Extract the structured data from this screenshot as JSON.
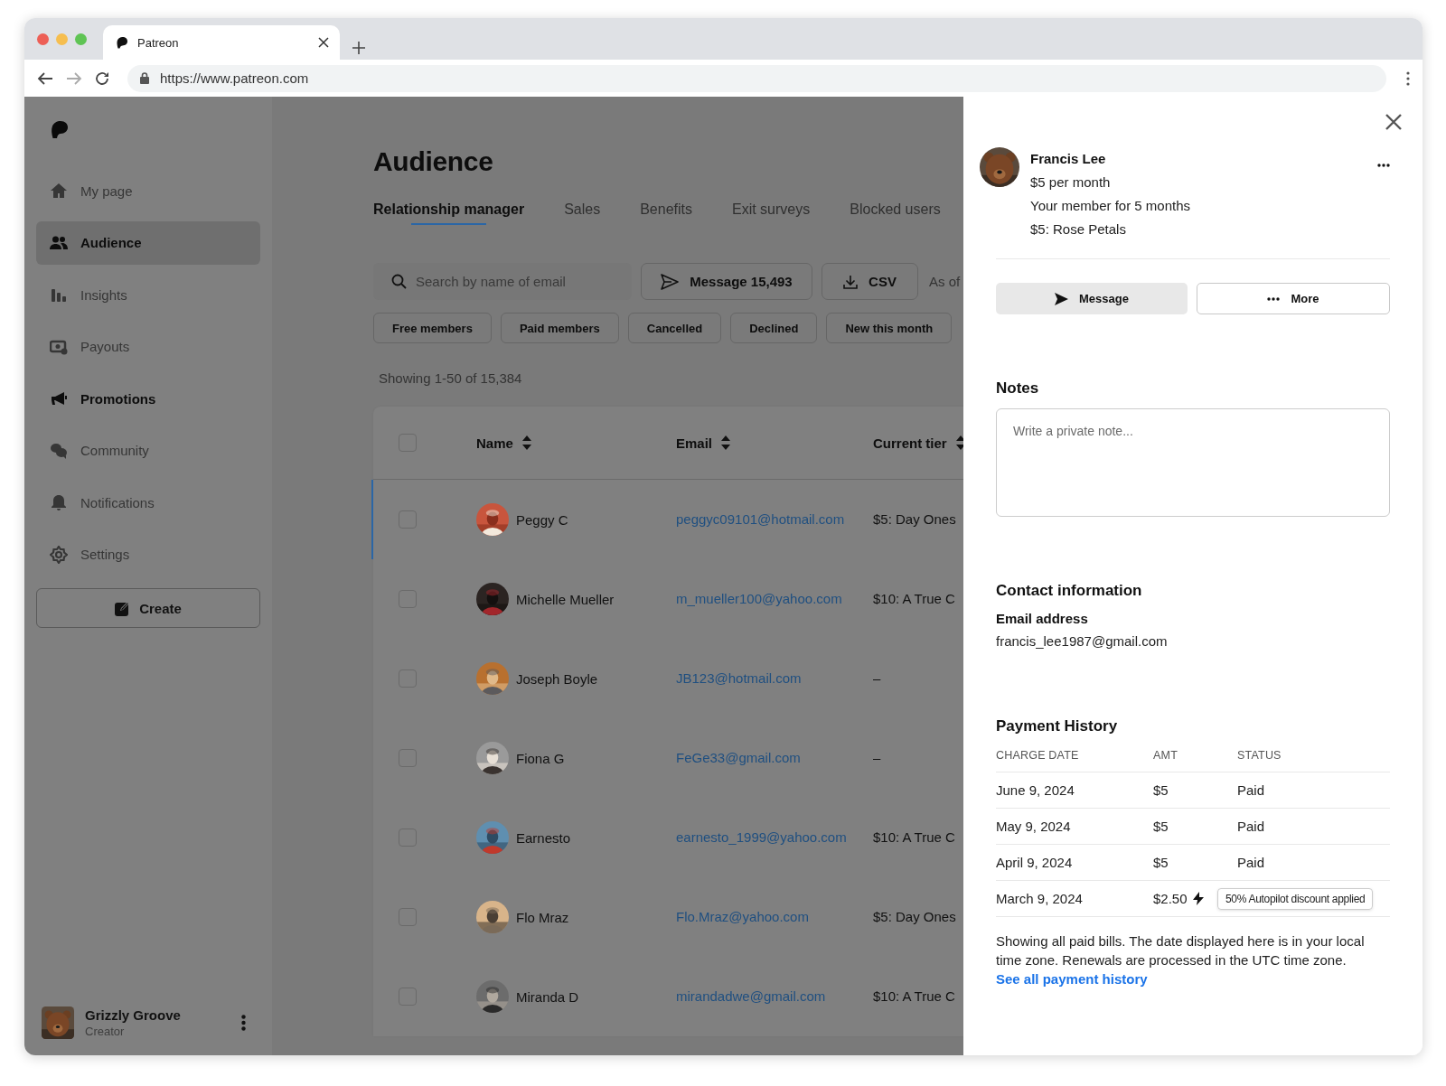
{
  "browser": {
    "tab_title": "Patreon",
    "url": "https://www.patreon.com"
  },
  "sidebar": {
    "items": [
      {
        "label": "My page",
        "selected": false,
        "emphasized": false
      },
      {
        "label": "Audience",
        "selected": true,
        "emphasized": false
      },
      {
        "label": "Insights",
        "selected": false,
        "emphasized": false
      },
      {
        "label": "Payouts",
        "selected": false,
        "emphasized": false
      },
      {
        "label": "Promotions",
        "selected": false,
        "emphasized": true
      },
      {
        "label": "Community",
        "selected": false,
        "emphasized": false
      },
      {
        "label": "Notifications",
        "selected": false,
        "emphasized": false
      },
      {
        "label": "Settings",
        "selected": false,
        "emphasized": false
      }
    ],
    "create_button": "Create",
    "account": {
      "name": "Grizzly Groove",
      "role": "Creator"
    }
  },
  "main": {
    "title": "Audience",
    "tabs": [
      {
        "label": "Relationship manager",
        "selected": true
      },
      {
        "label": "Sales",
        "selected": false
      },
      {
        "label": "Benefits",
        "selected": false
      },
      {
        "label": "Exit surveys",
        "selected": false
      },
      {
        "label": "Blocked users",
        "selected": false
      }
    ],
    "search": {
      "placeholder": "Search by name of email"
    },
    "message_button": "Message 15,493",
    "csv_button": "CSV",
    "as_of": "As of",
    "filters": [
      "Free members",
      "Paid members",
      "Cancelled",
      "Declined",
      "New this month"
    ],
    "showing": "Showing 1-50 of 15,384",
    "table": {
      "select_all": {
        "checked": false
      },
      "columns": [
        "Name",
        "Email",
        "Current tier"
      ],
      "rows": [
        {
          "name": "Peggy C",
          "email": "peggyc09101@hotmail.com",
          "tier": "$5: Day Ones",
          "selected": true,
          "checked": false
        },
        {
          "name": "Michelle Mueller",
          "email": "m_mueller100@yahoo.com",
          "tier": "$10: A True C",
          "selected": false,
          "checked": false
        },
        {
          "name": "Joseph Boyle",
          "email": "JB123@hotmail.com",
          "tier": "–",
          "selected": false,
          "checked": false
        },
        {
          "name": "Fiona G",
          "email": "FeGe33@gmail.com",
          "tier": "–",
          "selected": false,
          "checked": false
        },
        {
          "name": "Earnesto",
          "email": "earnesto_1999@yahoo.com",
          "tier": "$10: A True C",
          "selected": false,
          "checked": false
        },
        {
          "name": "Flo Mraz",
          "email": "Flo.Mraz@yahoo.com",
          "tier": "$5: Day Ones",
          "selected": false,
          "checked": false
        },
        {
          "name": "Miranda D",
          "email": "mirandadwe@gmail.com",
          "tier": "$10: A True C",
          "selected": false,
          "checked": false
        }
      ]
    }
  },
  "panel": {
    "member": {
      "name": "Francis Lee",
      "price": "$5 per month",
      "tenure": "Your member for 5 months",
      "tier": "$5: Rose Petals"
    },
    "message_button": "Message",
    "more_button": "More",
    "notes": {
      "title": "Notes",
      "placeholder": "Write a private note..."
    },
    "contact": {
      "title": "Contact information",
      "label": "Email address",
      "email": "francis_lee1987@gmail.com"
    },
    "payments": {
      "title": "Payment History",
      "columns": [
        "CHARGE DATE",
        "AMT",
        "STATUS"
      ],
      "rows": [
        {
          "kind": "paid",
          "date": "June 9, 2024",
          "amount": "$5",
          "status": "Paid"
        },
        {
          "kind": "paid",
          "date": "May 9, 2024",
          "amount": "$5",
          "status": "Paid"
        },
        {
          "kind": "paid",
          "date": "April 9, 2024",
          "amount": "$5",
          "status": "Paid"
        },
        {
          "kind": "discount",
          "date": "March 9, 2024",
          "amount": "$2.50",
          "status": "50% Autopilot discount applied"
        }
      ],
      "note": "Showing all paid bills. The date displayed here is in your local time zone. Renewals are processed in the UTC time zone.",
      "link": "See all payment history"
    }
  }
}
